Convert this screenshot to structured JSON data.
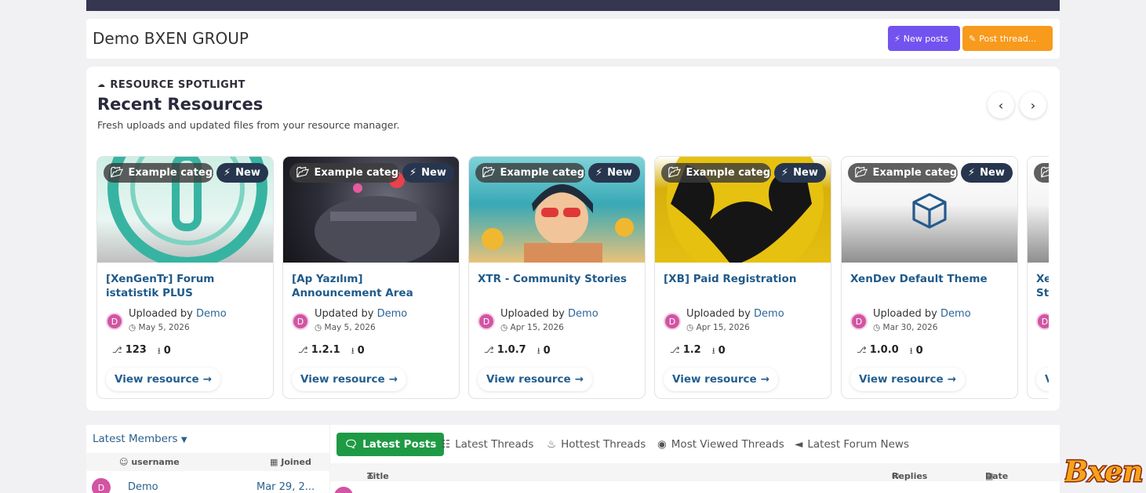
{
  "header": {
    "title": "Demo BXEN GROUP",
    "new_posts_label": "New posts",
    "post_thread_label": "Post thread..."
  },
  "spotlight": {
    "kicker": "RESOURCE SPOTLIGHT",
    "heading": "Recent Resources",
    "subtitle": "Fresh uploads and updated files from your resource manager.",
    "cards": [
      {
        "category": "Example category",
        "badge": "New",
        "title": "[XenGenTr] Forum istatistik PLUS",
        "action": "Uploaded by",
        "user": "Demo",
        "avatar": "D",
        "date": "May 5, 2026",
        "version": "123",
        "downloads": "0",
        "view": "View resource"
      },
      {
        "category": "Example category",
        "badge": "New",
        "title": "[Ap Yazılım] Announcement Area",
        "action": "Updated by",
        "user": "Demo",
        "avatar": "D",
        "date": "May 5, 2026",
        "version": "1.2.1",
        "downloads": "0",
        "view": "View resource"
      },
      {
        "category": "Example category",
        "badge": "New",
        "title": "XTR - Community Stories",
        "action": "Uploaded by",
        "user": "Demo",
        "avatar": "D",
        "date": "Apr 15, 2026",
        "version": "1.0.7",
        "downloads": "0",
        "view": "View resource"
      },
      {
        "category": "Example category",
        "badge": "New",
        "title": "[XB] Paid Registration",
        "action": "Uploaded by",
        "user": "Demo",
        "avatar": "D",
        "date": "Apr 15, 2026",
        "version": "1.2",
        "downloads": "0",
        "view": "View resource"
      },
      {
        "category": "Example category",
        "badge": "New",
        "title": "XenDev Default Theme",
        "action": "Uploaded by",
        "user": "Demo",
        "avatar": "D",
        "date": "Mar 30, 2026",
        "version": "1.0.0",
        "downloads": "0",
        "view": "View resource"
      },
      {
        "category": "",
        "badge": "",
        "title": "Xe St",
        "action": "",
        "user": "",
        "avatar": "D",
        "date": "",
        "version": "",
        "downloads": "",
        "view": "V"
      }
    ]
  },
  "members": {
    "title": "Latest Members",
    "col_username": "username",
    "col_joined": "Joined",
    "rows": [
      {
        "avatar": "D",
        "name": "Demo",
        "joined": "Mar 29, 2..."
      }
    ]
  },
  "posts": {
    "tabs": [
      "Latest Posts",
      "Latest Threads",
      "Hottest Threads",
      "Most Viewed Threads",
      "Latest Forum News"
    ],
    "col_title": "Title",
    "col_replies": "Replies",
    "col_date": "Date"
  },
  "logo_text": "Bxen",
  "colors": {
    "accent_purple": "#7353ef",
    "accent_orange": "#f89a1c",
    "accent_green": "#1e9a45",
    "link": "#2a6598",
    "topbar": "#353650"
  }
}
